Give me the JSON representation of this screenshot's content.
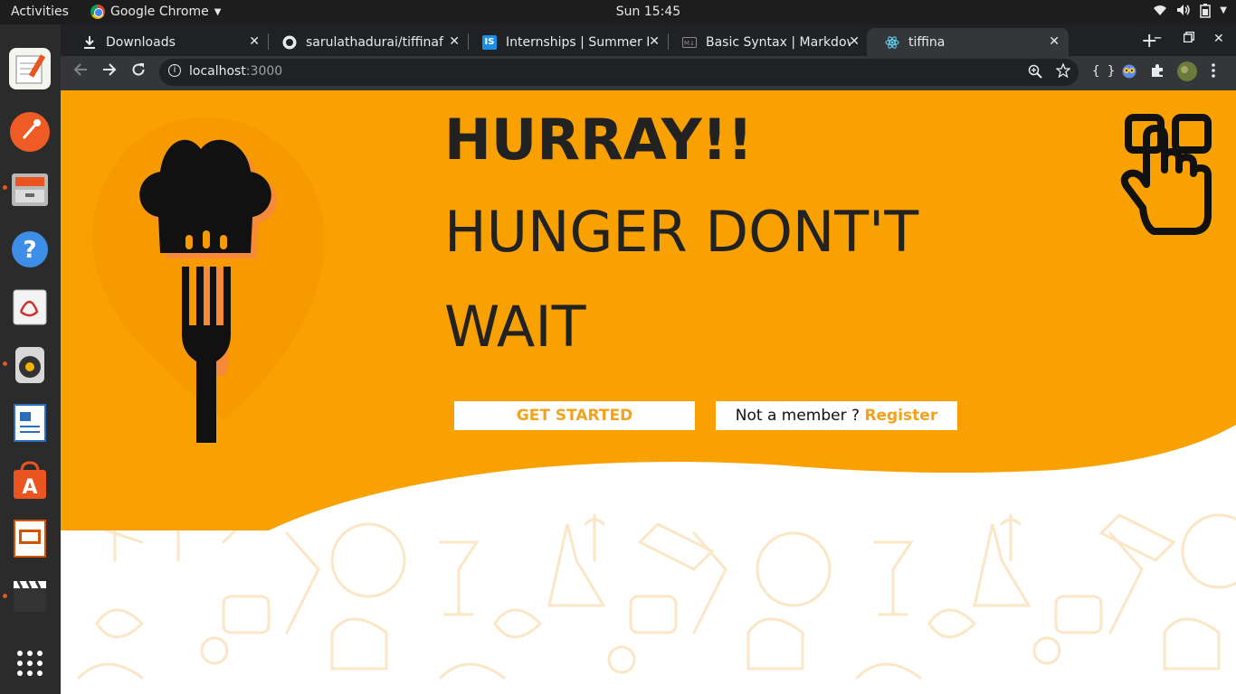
{
  "system": {
    "activities": "Activities",
    "app_name": "Google Chrome",
    "clock": "Sun 15:45"
  },
  "tabs": [
    {
      "title": "Downloads",
      "icon": "download-icon"
    },
    {
      "title": "sarulathadurai/tiffinaf",
      "icon": "github-icon"
    },
    {
      "title": "Internships | Summer In",
      "icon": "internshala-icon"
    },
    {
      "title": "Basic Syntax | Markdow",
      "icon": "markdown-icon"
    },
    {
      "title": "tiffina",
      "icon": "react-icon"
    }
  ],
  "address": {
    "host": "localhost",
    "port": ":3000"
  },
  "hero": {
    "title": "HURRAY!!",
    "subtitle_line1": "HUNGER DONT'T",
    "subtitle_line2": "WAIT",
    "get_started": "GET STARTED",
    "not_member": "Not a member ? ",
    "register": "Register"
  },
  "colors": {
    "brand_orange": "#f8a100",
    "accent_text": "#f4a21b"
  }
}
